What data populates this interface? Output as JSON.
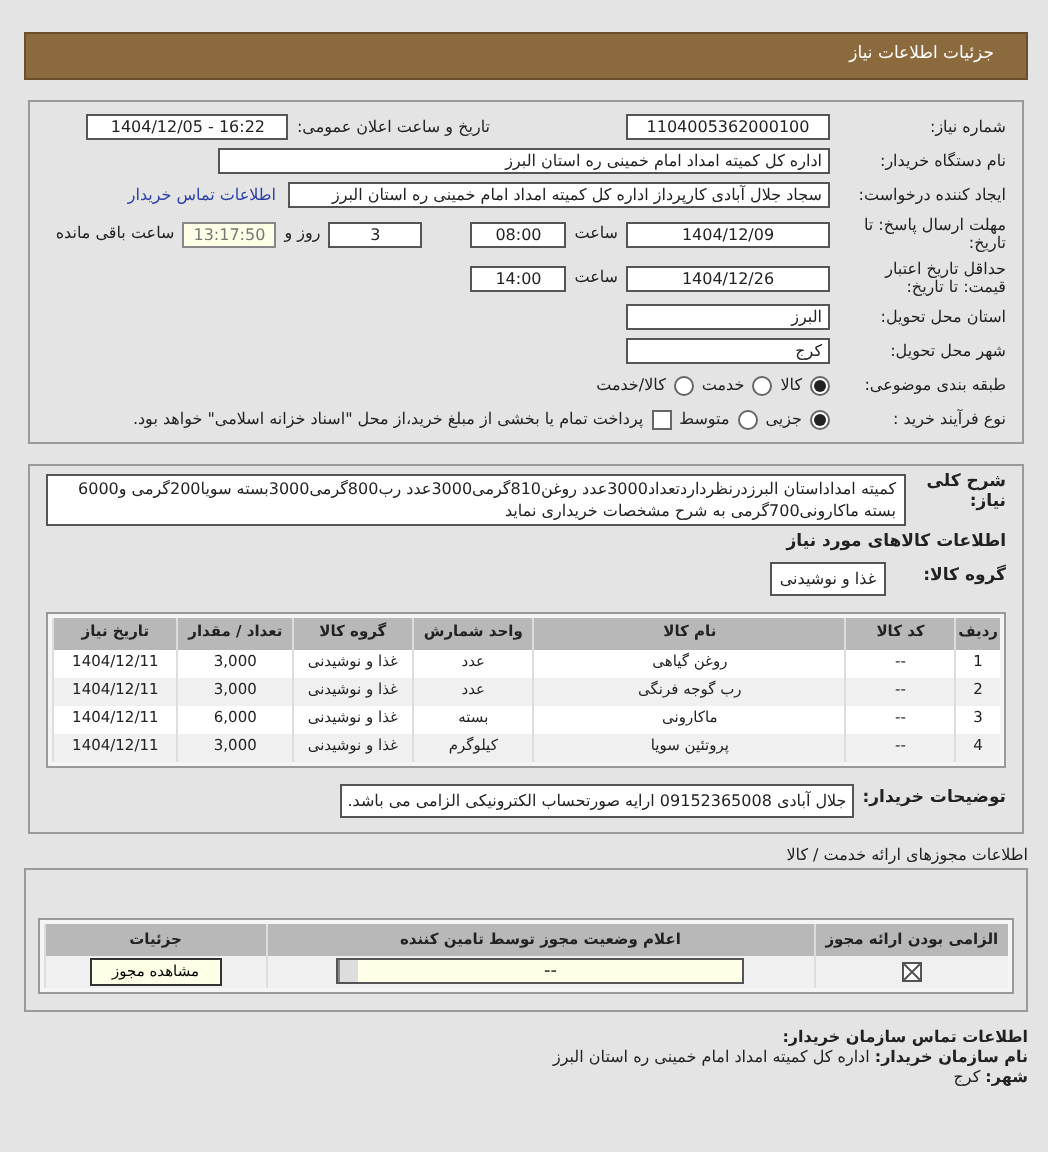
{
  "header": {
    "title": "جزئیات اطلاعات نیاز"
  },
  "need_number": {
    "label": "شماره نیاز:",
    "value": "1104005362000100"
  },
  "announce": {
    "label": "تاریخ و ساعت اعلان عمومی:",
    "value": "1404/12/05 - 16:22"
  },
  "buyer_org": {
    "label": "نام دستگاه خریدار:",
    "value": "اداره کل کمیته امداد امام خمینی  ره  استان البرز"
  },
  "requester": {
    "label": "ایجاد کننده درخواست:",
    "value": "سجاد جلال آبادی کارپرداز اداره کل کمیته امداد امام خمینی  ره  استان البرز",
    "link": "اطلاعات تماس خریدار"
  },
  "deadline": {
    "label": "مهلت ارسال پاسخ: تا تاریخ:",
    "date": "1404/12/09",
    "time_label": "ساعت",
    "time": "08:00",
    "days": "3",
    "days_label": "روز و",
    "remaining": "13:17:50",
    "remaining_label": "ساعت باقی مانده"
  },
  "validity": {
    "label": "حداقل تاریخ اعتبار قیمت: تا تاریخ:",
    "date": "1404/12/26",
    "time_label": "ساعت",
    "time": "14:00"
  },
  "province": {
    "label": "استان محل تحویل:",
    "value": "البرز"
  },
  "city": {
    "label": "شهر محل تحویل:",
    "value": "کرج"
  },
  "category": {
    "label": "طبقه بندی موضوعی:",
    "options": [
      {
        "label": "کالا",
        "selected": true
      },
      {
        "label": "خدمت",
        "selected": false
      },
      {
        "label": "کالا/خدمت",
        "selected": false
      }
    ]
  },
  "process": {
    "label": "نوع فرآیند خرید :",
    "options": [
      {
        "label": "جزیی",
        "selected": true
      },
      {
        "label": "متوسط",
        "selected": false
      }
    ],
    "payment": {
      "checked": false,
      "label": "پرداخت تمام یا بخشی از مبلغ خرید،از محل \"اسناد خزانه اسلامی\" خواهد بود."
    }
  },
  "description": {
    "label": "شرح کلی نیاز:",
    "value": "کمیته امداداستان البرزدرنظرداردتعداد3000عدد روغن810گرمی3000عدد رب800گرمی3000بسته سویا200گرمی و6000 بسته ماکارونی700گرمی به شرح مشخصات خریداری نماید"
  },
  "goods_title": "اطلاعات کالاهای مورد نیاز",
  "goods_group": {
    "label": "گروه کالا:",
    "value": "غذا و نوشیدنی"
  },
  "table": {
    "columns": [
      "ردیف",
      "کد کالا",
      "نام کالا",
      "واحد شمارش",
      "گروه کالا",
      "تعداد / مقدار",
      "تاریخ نیاز"
    ],
    "rows": [
      [
        "1",
        "--",
        "روغن گیاهی",
        "عدد",
        "غذا و نوشیدنی",
        "3,000",
        "1404/12/11"
      ],
      [
        "2",
        "--",
        "رب گوجه فرنگی",
        "عدد",
        "غذا و نوشیدنی",
        "3,000",
        "1404/12/11"
      ],
      [
        "3",
        "--",
        "ماکارونی",
        "بسته",
        "غذا و نوشیدنی",
        "6,000",
        "1404/12/11"
      ],
      [
        "4",
        "--",
        "پروتئین سویا",
        "کیلوگرم",
        "غذا و نوشیدنی",
        "3,000",
        "1404/12/11"
      ]
    ]
  },
  "buyer_notes": {
    "label": "توضیحات خریدار:",
    "value": "جلال آبادی 09152365008 ارایه صورتحساب الکترونیکی الزامی می باشد."
  },
  "licenses": {
    "title": "اطلاعات مجوزهای ارائه خدمت / کالا",
    "columns": [
      "الزامی بودن ارائه مجوز",
      "اعلام وضعیت مجوز توسط تامین کننده",
      "جزئیات"
    ],
    "rows": [
      {
        "required": true,
        "status": "--",
        "button": "مشاهده مجوز"
      }
    ]
  },
  "contact": {
    "title": "اطلاعات تماس سازمان خریدار:",
    "lines": [
      {
        "label": "نام سازمان خریدار:",
        "value": "اداره کل کمیته امداد امام خمینی ره استان البرز"
      },
      {
        "label": "شهر:",
        "value": "کرج"
      }
    ]
  }
}
